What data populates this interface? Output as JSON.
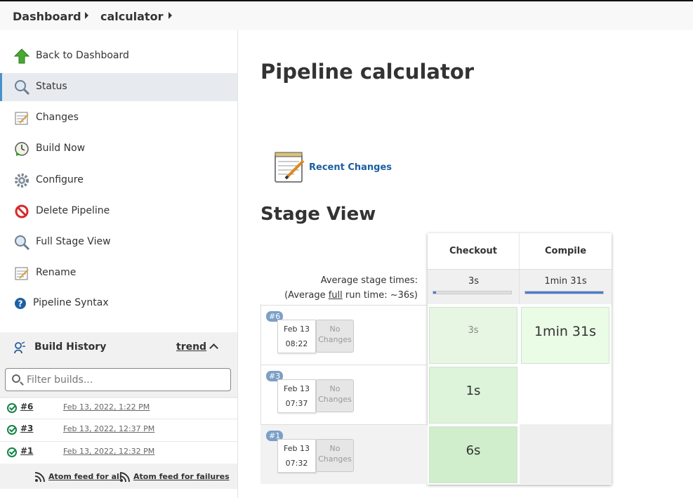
{
  "breadcrumb": {
    "items": [
      "Dashboard",
      "calculator"
    ]
  },
  "sidebar": {
    "tasks": [
      {
        "label": "Back to Dashboard",
        "icon": "arrow-up-icon"
      },
      {
        "label": "Status",
        "icon": "magnifier-icon"
      },
      {
        "label": "Changes",
        "icon": "notepad-icon"
      },
      {
        "label": "Build Now",
        "icon": "clock-icon"
      },
      {
        "label": "Configure",
        "icon": "gear-icon"
      },
      {
        "label": "Delete Pipeline",
        "icon": "no-entry-icon"
      },
      {
        "label": "Full Stage View",
        "icon": "magnifier-icon"
      },
      {
        "label": "Rename",
        "icon": "notepad-icon"
      },
      {
        "label": "Pipeline Syntax",
        "icon": "help-icon"
      }
    ],
    "active_task": "Status"
  },
  "build_history": {
    "title": "Build History",
    "trend_label": "trend",
    "filter_placeholder": "Filter builds...",
    "builds": [
      {
        "number": "#6",
        "date": "Feb 13, 2022, 1:22 PM",
        "status": "success"
      },
      {
        "number": "#3",
        "date": "Feb 13, 2022, 12:37 PM",
        "status": "success"
      },
      {
        "number": "#1",
        "date": "Feb 13, 2022, 12:32 PM",
        "status": "success"
      }
    ],
    "feeds": {
      "all": "Atom feed for all",
      "failures": "Atom feed for failures"
    }
  },
  "main": {
    "title": "Pipeline calculator",
    "recent_changes": "Recent Changes",
    "stage_view_title": "Stage View",
    "avg_stage_times_label": "Average stage times:",
    "avg_full_prefix": "(Average ",
    "avg_full_word": "full",
    "avg_full_suffix": " run time: ~36s)",
    "stages": [
      {
        "name": "Checkout",
        "avg": "3s",
        "avg_fraction": 0.03
      },
      {
        "name": "Compile",
        "avg": "1min 31s",
        "avg_fraction": 1.0
      }
    ],
    "runs": [
      {
        "badge": "#6",
        "date": "Feb 13",
        "time": "08:22",
        "changes": "No Changes",
        "cells": [
          {
            "value": "3s",
            "bg": "#e6f6e3",
            "faded": true
          },
          {
            "value": "1min 31s",
            "bg": "#eafbe6",
            "faded": false
          }
        ]
      },
      {
        "badge": "#3",
        "date": "Feb 13",
        "time": "07:37",
        "changes": "No Changes",
        "cells": [
          {
            "value": "1s",
            "bg": "#ddf4da",
            "faded": false
          },
          null
        ]
      },
      {
        "badge": "#1",
        "date": "Feb 13",
        "time": "07:32",
        "changes": "No Changes",
        "cells": [
          {
            "value": "6s",
            "bg": "#d0edcc",
            "faded": false
          },
          null
        ]
      }
    ]
  },
  "colors": {
    "success": "#138347",
    "link": "#1c5fa0",
    "badge": "#7b9fc7",
    "active_task_bg": "#e7ebef",
    "avg_bar": "#4a7bd0"
  }
}
